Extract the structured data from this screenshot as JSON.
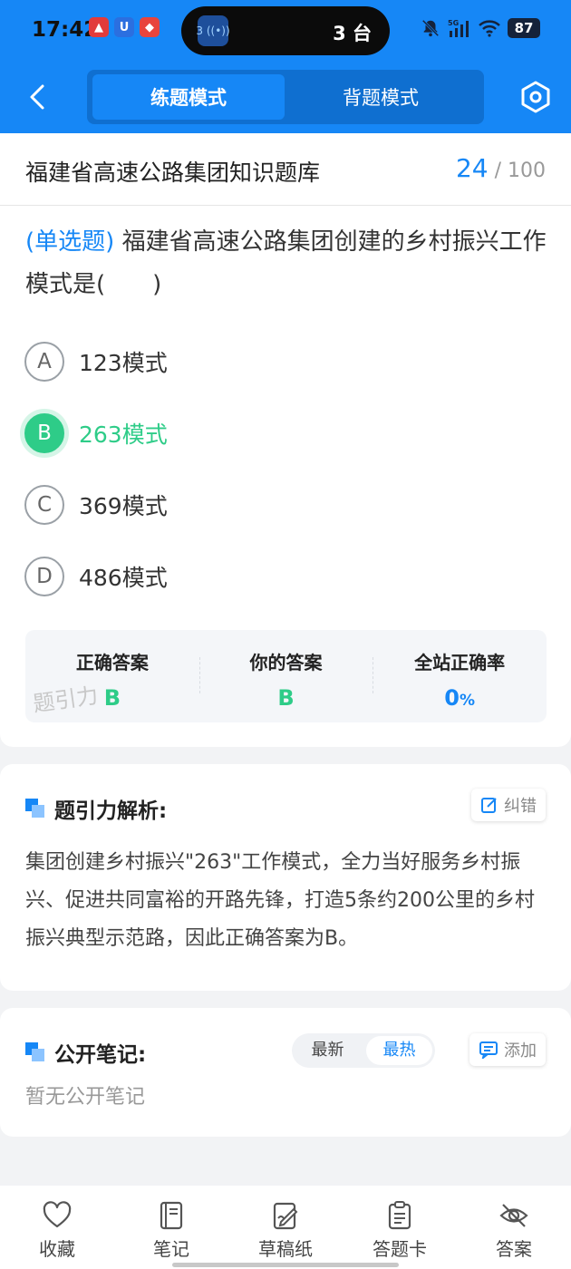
{
  "status_bar": {
    "time": "17:42",
    "island_badge": "3",
    "island_text": "3 台",
    "battery": "87",
    "network": "5G"
  },
  "header": {
    "modes": [
      "练题模式",
      "背题模式"
    ],
    "active_mode": "练题模式",
    "accent_color": "#1687f6"
  },
  "bank": {
    "title": "福建省高速公路集团知识题库",
    "current": "24",
    "separator": "/",
    "total": "100"
  },
  "question": {
    "type_label": "(单选题)",
    "text": "福建省高速公路集团创建的乡村振兴工作模式是(　　)",
    "options": [
      {
        "letter": "A",
        "text": "123模式"
      },
      {
        "letter": "B",
        "text": "263模式"
      },
      {
        "letter": "C",
        "text": "369模式"
      },
      {
        "letter": "D",
        "text": "486模式"
      }
    ],
    "correct_color": "#2ecc88"
  },
  "answer_summary": {
    "correct_label": "正确答案",
    "correct_value": "B",
    "yours_label": "你的答案",
    "yours_value": "B",
    "rate_label": "全站正确率",
    "rate_value": "0",
    "rate_unit": "%"
  },
  "watermark": "题引力",
  "analysis": {
    "title": "题引力解析:",
    "report_button": "纠错",
    "text": "集团创建乡村振兴\"263\"工作模式，全力当好服务乡村振兴、促进共同富裕的开路先锋，打造5条约200公里的乡村振兴典型示范路，因此正确答案为B。"
  },
  "notes": {
    "title": "公开笔记:",
    "sort_options": [
      "最新",
      "最热"
    ],
    "active_sort": "最热",
    "add_button": "添加",
    "empty_text": "暂无公开笔记"
  },
  "bottom_nav": [
    {
      "label": "收藏",
      "icon": "heart-icon"
    },
    {
      "label": "笔记",
      "icon": "notebook-icon"
    },
    {
      "label": "草稿纸",
      "icon": "draft-icon"
    },
    {
      "label": "答题卡",
      "icon": "answer-sheet-icon"
    },
    {
      "label": "答案",
      "icon": "eye-slash-icon"
    }
  ]
}
